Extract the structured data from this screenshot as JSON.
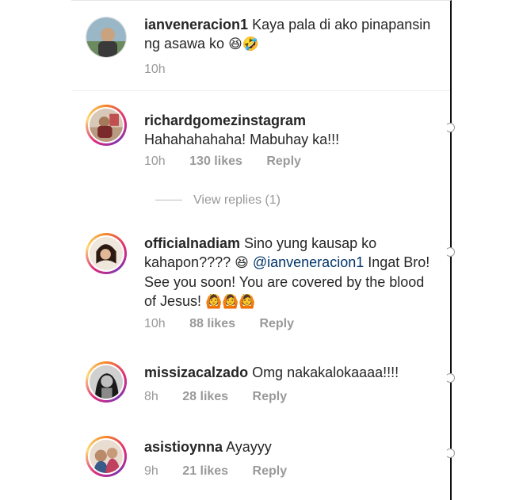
{
  "comments": [
    {
      "username": "ianveneracion1",
      "text": " Kaya pala di ako pinapansin ng asawa ko ",
      "emoji": "😆🤣",
      "time": "10h",
      "likes": "",
      "reply": ""
    },
    {
      "username": "richardgomezinstagram",
      "text": "Hahahahahaha! Mabuhay ka!!!",
      "time": "10h",
      "likes": "130 likes",
      "reply": "Reply"
    },
    {
      "username": "officialnadiam",
      "text_a": " Sino yung kausap ko kahapon???? ",
      "emoji_a": "😆",
      "mention": "@ianveneracion1",
      "text_b": " Ingat Bro! See you soon! You are covered by the blood of Jesus! ",
      "emoji_b": "🙆🙆🙆",
      "time": "10h",
      "likes": "88 likes",
      "reply": "Reply"
    },
    {
      "username": "missizacalzado",
      "text": " Omg nakakalokaaaa!!!!",
      "time": "8h",
      "likes": "28 likes",
      "reply": "Reply"
    },
    {
      "username": "asistioynna",
      "text": " Ayayyy",
      "time": "9h",
      "likes": "21 likes",
      "reply": "Reply"
    }
  ],
  "view_replies": "View replies (1)",
  "colors": {
    "ring_start": "#f58529",
    "ring_mid": "#dd2a7b",
    "mention": "#003569",
    "meta": "#999999"
  }
}
